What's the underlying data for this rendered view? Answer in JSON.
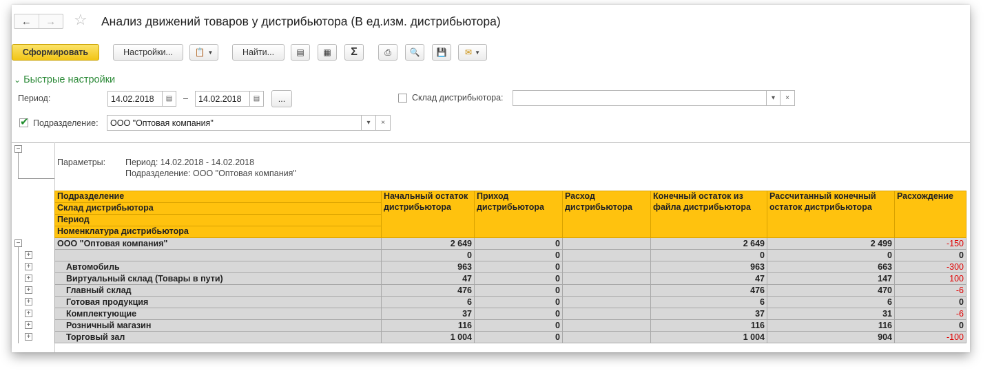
{
  "window": {
    "title": "Анализ движений товаров у дистрибьютора (В ед.изм. дистрибьютора)",
    "nav_back": "←",
    "nav_forward": "→",
    "star": "☆"
  },
  "toolbar": {
    "generate_label": "Сформировать",
    "settings_label": "Настройки...",
    "find_label": "Найти...",
    "sum_label": "Σ"
  },
  "quick_settings": {
    "toggle_label": "Быстрые настройки",
    "period_label": "Период:",
    "date_from": "14.02.2018",
    "date_to": "14.02.2018",
    "dash": "–",
    "more_label": "...",
    "warehouse_label": "Склад дистрибьютора:",
    "warehouse_value": "",
    "warehouse_checked": false,
    "division_label": "Подразделение:",
    "division_value": "ООО \"Оптовая компания\"",
    "division_checked": true
  },
  "report": {
    "params_label": "Параметры:",
    "param_period": "Период: 14.02.2018 - 14.02.2018",
    "param_division": "Подразделение: ООО \"Оптовая компания\"",
    "group_headers": [
      "Подразделение",
      "Склад дистрибьютора",
      "Период",
      "Номенклатура дистрибьютора"
    ],
    "columns": [
      "Начальный остаток дистрибьютора",
      "Приход дистрибьютора",
      "Расход дистрибьютора",
      "Конечный остаток из файла дистрибьютора",
      "Рассчитанный конечный остаток дистрибьютора",
      "Расхождение"
    ],
    "rows": [
      {
        "name": "ООО \"Оптовая компания\"",
        "start": "2 649",
        "in": "0",
        "out": "",
        "end_file": "2 649",
        "end_calc": "2 499",
        "diff": "-150",
        "level": 0
      },
      {
        "name": "",
        "start": "0",
        "in": "0",
        "out": "",
        "end_file": "0",
        "end_calc": "0",
        "diff": "0",
        "level": 1
      },
      {
        "name": "Автомобиль",
        "start": "963",
        "in": "0",
        "out": "",
        "end_file": "963",
        "end_calc": "663",
        "diff": "-300",
        "level": 1
      },
      {
        "name": "Виртуальный склад (Товары в пути)",
        "start": "47",
        "in": "0",
        "out": "",
        "end_file": "47",
        "end_calc": "147",
        "diff": "100",
        "level": 1
      },
      {
        "name": "Главный склад",
        "start": "476",
        "in": "0",
        "out": "",
        "end_file": "476",
        "end_calc": "470",
        "diff": "-6",
        "level": 1
      },
      {
        "name": "Готовая продукция",
        "start": "6",
        "in": "0",
        "out": "",
        "end_file": "6",
        "end_calc": "6",
        "diff": "0",
        "level": 1
      },
      {
        "name": "Комплектующие",
        "start": "37",
        "in": "0",
        "out": "",
        "end_file": "37",
        "end_calc": "31",
        "diff": "-6",
        "level": 1
      },
      {
        "name": "Розничный магазин",
        "start": "116",
        "in": "0",
        "out": "",
        "end_file": "116",
        "end_calc": "116",
        "diff": "0",
        "level": 1
      },
      {
        "name": "Торговый зал",
        "start": "1 004",
        "in": "0",
        "out": "",
        "end_file": "1 004",
        "end_calc": "904",
        "diff": "-100",
        "level": 1
      }
    ]
  },
  "colors": {
    "primary_button": "#f2c516",
    "header_fill": "#ffc20e",
    "row_fill": "#d8d8d8",
    "negative": "#e00000",
    "quick_settings": "#2e8b3a"
  }
}
